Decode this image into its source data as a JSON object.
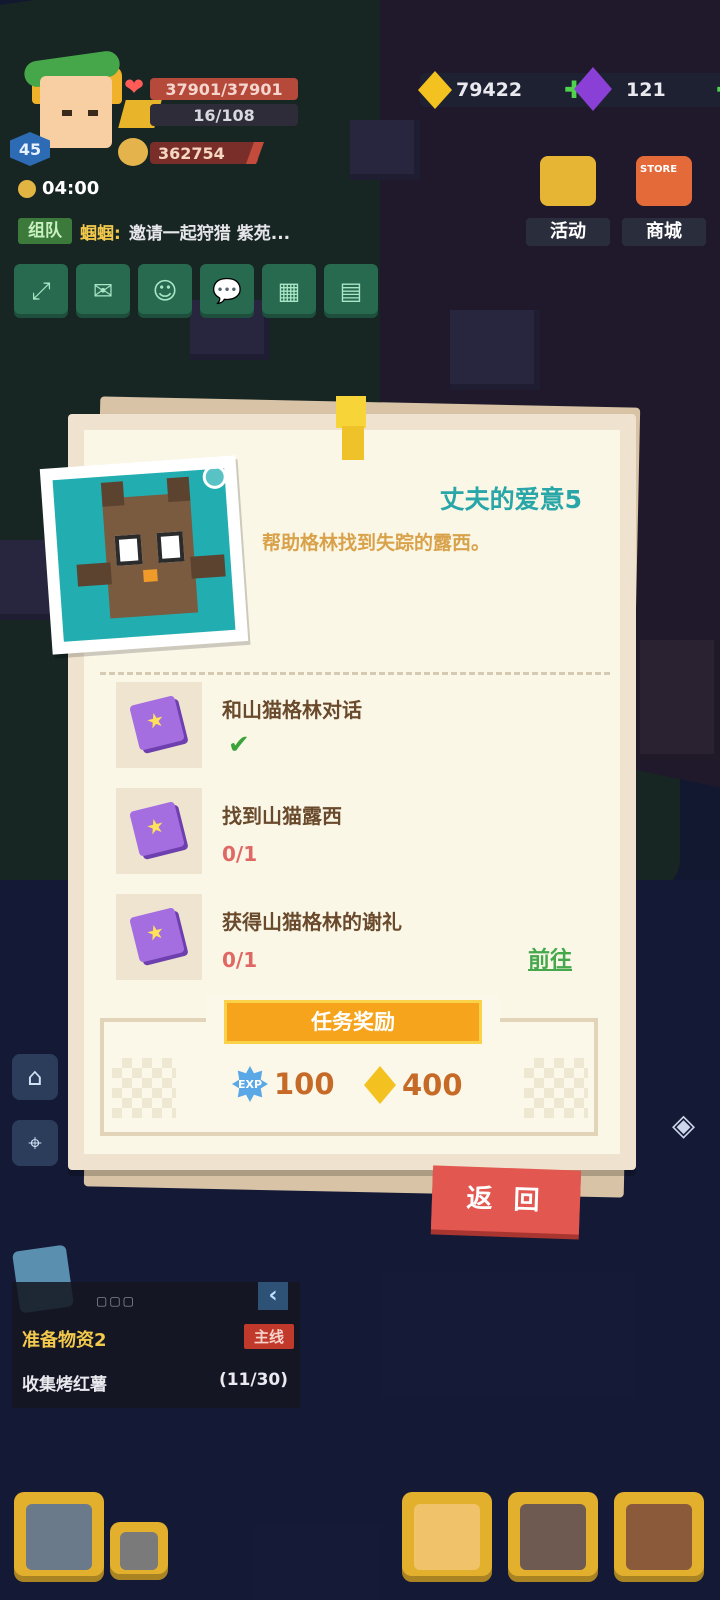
{
  "player": {
    "level": "45",
    "hp": "37901/37901",
    "stamina": "16/108",
    "power": "362754",
    "time": "04:00"
  },
  "currency": {
    "gold": "79422",
    "gems": "121"
  },
  "top_buttons": {
    "events": "活动",
    "store_tag": "STORE",
    "store": "商城"
  },
  "chat": {
    "channel": "组队",
    "sender": "蝈蝈:",
    "message": "邀请一起狩猎 紫苑..."
  },
  "quest": {
    "title": "丈夫的爱意5",
    "description": "帮助格林找到失踪的露西。",
    "tasks": [
      {
        "name": "和山猫格林对话",
        "progress": "",
        "done": true
      },
      {
        "name": "找到山猫露西",
        "progress": "0/1",
        "done": false
      },
      {
        "name": "获得山猫格林的谢礼",
        "progress": "0/1",
        "done": false,
        "action": "前往"
      }
    ],
    "reward_header": "任务奖励",
    "rewards": {
      "exp_label": "EXP",
      "exp": "100",
      "gold": "400"
    },
    "back_button": "返 回"
  },
  "tracker": {
    "dots": "▢▢▢",
    "collapse": "‹",
    "title": "准备物资2",
    "badge": "主线",
    "subtask": "收集烤红薯",
    "count": "(11/30)"
  },
  "icons": {
    "checkmark": "✔",
    "plus": "✚",
    "heart": "❤"
  },
  "colors": {
    "quest_title": "#29a6a8",
    "description": "#d9a24a",
    "progress": "#e06864",
    "go_link": "#45a84d",
    "reward_bar": "#f5a41b",
    "back_button": "#e2574f"
  }
}
